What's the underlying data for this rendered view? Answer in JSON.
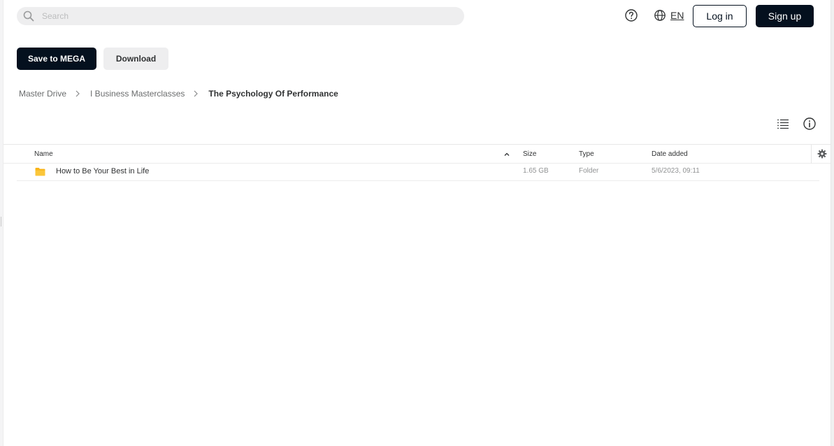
{
  "search": {
    "placeholder": "Search",
    "icon": "search-icon"
  },
  "header": {
    "help_icon": "help-circle-icon",
    "language_icon": "globe-icon",
    "language": "EN",
    "login_label": "Log in",
    "signup_label": "Sign up"
  },
  "actions": {
    "save_label": "Save to MEGA",
    "download_label": "Download"
  },
  "breadcrumb": {
    "items": [
      "Master Drive",
      "I Business Masterclasses",
      "The Psychology Of Performance"
    ]
  },
  "view_controls": {
    "list_icon": "list-view-icon",
    "info_icon": "info-icon"
  },
  "table": {
    "columns": {
      "name": "Name",
      "size": "Size",
      "type": "Type",
      "date": "Date added"
    },
    "sort": {
      "column": "Name",
      "direction": "ascending"
    },
    "rows": [
      {
        "icon": "folder-icon",
        "name": "How to Be Your Best in Life",
        "size": "1.65 GB",
        "type": "Folder",
        "date": "5/6/2023, 09:11"
      }
    ]
  },
  "colors": {
    "primary_dark": "#04101e",
    "folder_yellow": "#f9b417",
    "search_bg": "#eeeeef",
    "text": "#303233",
    "muted_text": "#909293"
  }
}
